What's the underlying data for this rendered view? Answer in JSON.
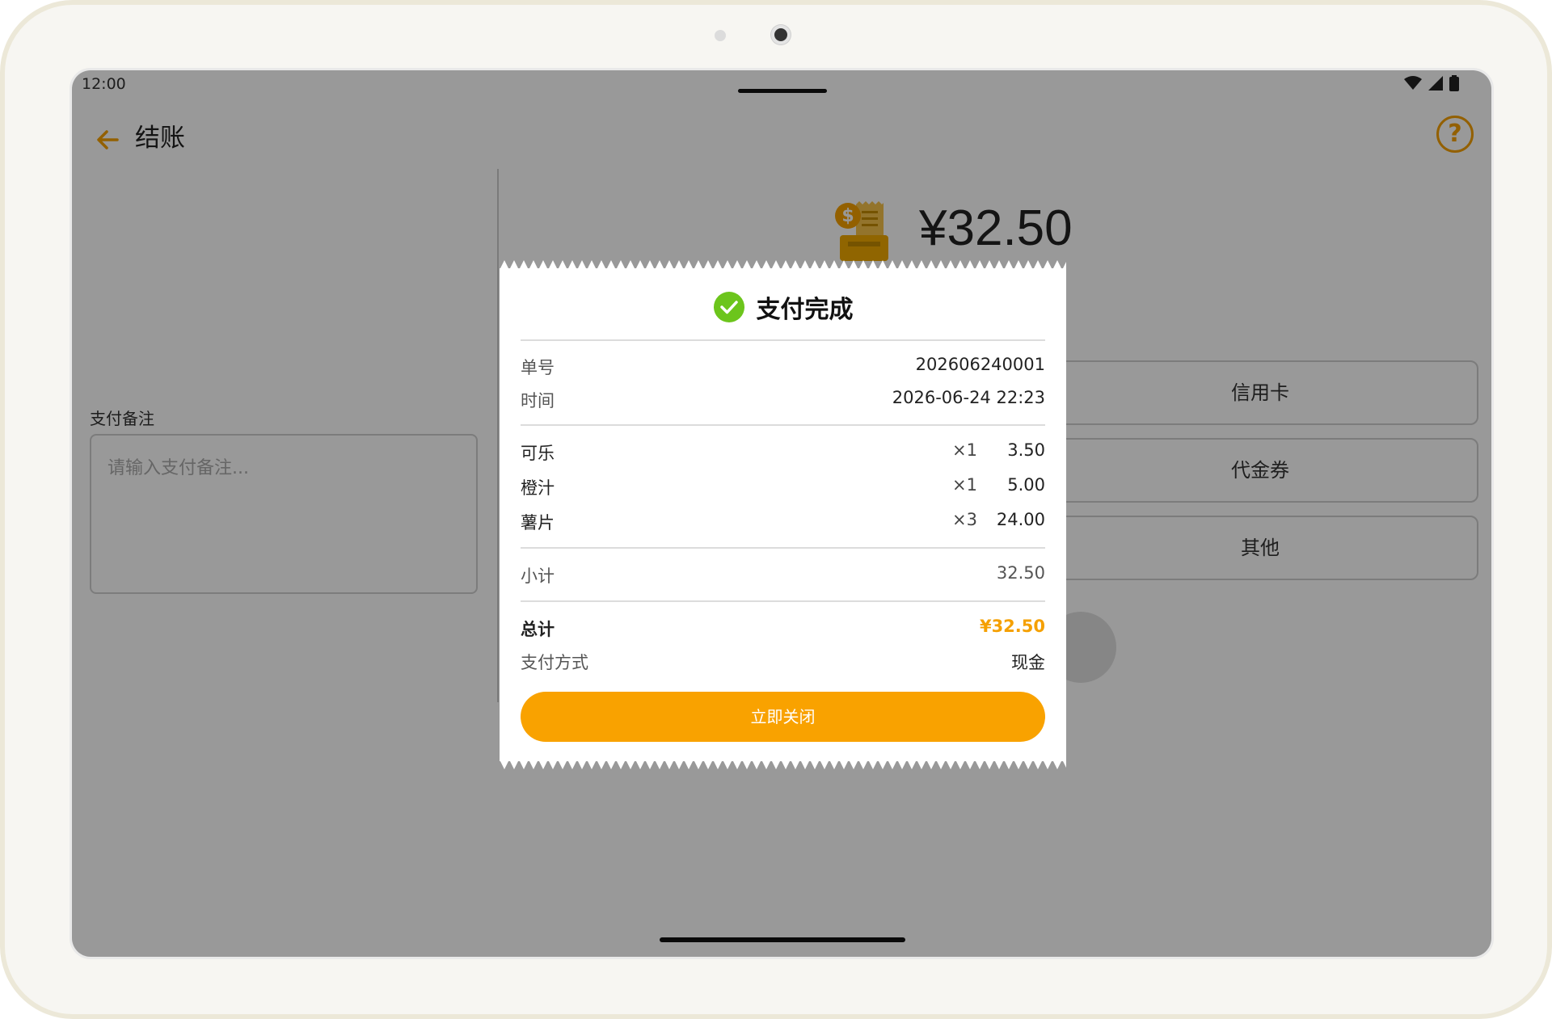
{
  "status": {
    "time": "12:00"
  },
  "appbar": {
    "title": "结账",
    "help_label": "?"
  },
  "note": {
    "label": "支付备注",
    "placeholder": "请输入支付备注..."
  },
  "amount": {
    "display": "¥32.50"
  },
  "payment_methods": [
    {
      "label": "信用卡"
    },
    {
      "label": "代金券"
    },
    {
      "label": "其他"
    }
  ],
  "receipt": {
    "title": "支付完成",
    "order_no_label": "单号",
    "order_no": "202606240001",
    "time_label": "时间",
    "time": "2026-06-24 22:23",
    "items": [
      {
        "name": "可乐",
        "qty": "×1",
        "price": "3.50"
      },
      {
        "name": "橙汁",
        "qty": "×1",
        "price": "5.00"
      },
      {
        "name": "薯片",
        "qty": "×3",
        "price": "24.00"
      }
    ],
    "subtotal_label": "小计",
    "subtotal": "32.50",
    "total_label": "总计",
    "total": "¥32.50",
    "method_label": "支付方式",
    "method": "现金",
    "close_label": "立即关闭"
  },
  "colors": {
    "accent": "#f5a000",
    "success": "#6cc51c"
  }
}
